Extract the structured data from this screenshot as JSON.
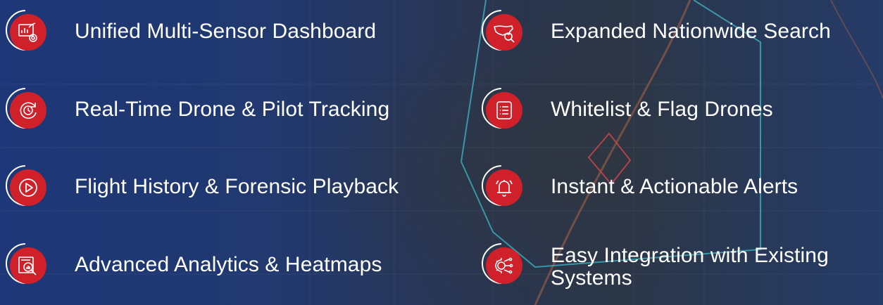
{
  "features": {
    "left": [
      {
        "label": "Unified Multi-Sensor Dashboard",
        "icon": "dashboard-analytics-icon"
      },
      {
        "label": "Real-Time Drone & Pilot Tracking",
        "icon": "clock-refresh-icon"
      },
      {
        "label": "Flight History & Forensic Playback",
        "icon": "play-circle-icon"
      },
      {
        "label": "Advanced Analytics & Heatmaps",
        "icon": "report-magnifier-icon"
      }
    ],
    "right": [
      {
        "label": "Expanded Nationwide Search",
        "icon": "us-map-search-icon"
      },
      {
        "label": "Whitelist & Flag Drones",
        "icon": "list-document-icon"
      },
      {
        "label": "Instant & Actionable Alerts",
        "icon": "bell-alert-icon"
      },
      {
        "label": "Easy Integration with Existing Systems",
        "icon": "gear-circuit-icon"
      }
    ]
  },
  "colors": {
    "accent": "#d0202a",
    "text": "#ffffff",
    "background": "#1f3672",
    "map_outline": "#3fb7c6"
  }
}
